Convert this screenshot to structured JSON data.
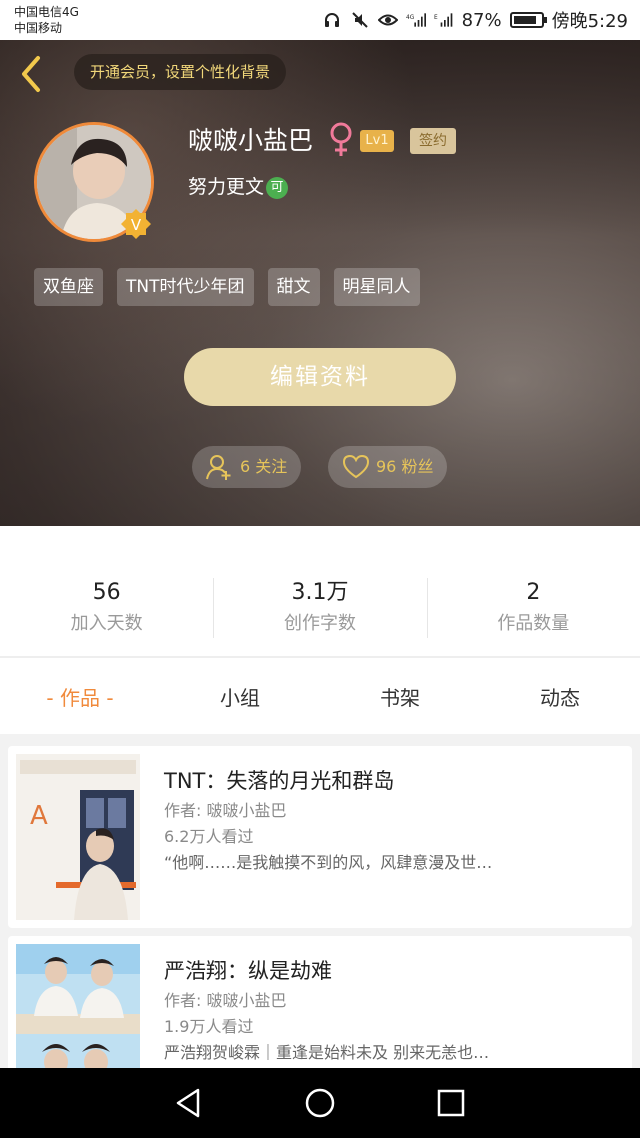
{
  "status_bar": {
    "carrier_line1": "中国电信4G",
    "carrier_line2": "中国移动",
    "battery_percent": "87%",
    "battery_level": 0.87,
    "time": "傍晚5:29",
    "icons": [
      "headphones-icon",
      "mute-icon",
      "eye-icon",
      "signal-4g-icon",
      "signal-e-icon",
      "battery-icon"
    ]
  },
  "header": {
    "vip_prompt": "开通会员，设置个性化背景",
    "username": "啵啵小盐巴",
    "gender_symbol": "♀",
    "level": "Lv1",
    "sign_badge": "签约",
    "motto": "努力更文",
    "motto_badge": "可",
    "verified_badge": "V",
    "tags": [
      "双鱼座",
      "TNT时代少年团",
      "甜文",
      "明星同人"
    ],
    "edit_button": "编辑资料",
    "follow_count": "6 关注",
    "fans_count": "96 粉丝",
    "accent_color": "#e6c45a"
  },
  "stats": [
    {
      "value": "56",
      "label": "加入天数"
    },
    {
      "value": "3.1万",
      "label": "创作字数"
    },
    {
      "value": "2",
      "label": "作品数量"
    }
  ],
  "tabs": [
    {
      "label": "- 作品 -",
      "active": true
    },
    {
      "label": "小组",
      "active": false
    },
    {
      "label": "书架",
      "active": false
    },
    {
      "label": "动态",
      "active": false
    }
  ],
  "books": [
    {
      "title": "TNT：失落的月光和群岛",
      "author": "作者: 啵啵小盐巴",
      "views": "6.2万人看过",
      "description": "“他啊……是我触摸不到的风，风肆意漫及世…"
    },
    {
      "title": "严浩翔：纵是劫难",
      "author": "作者: 啵啵小盐巴",
      "views": "1.9万人看过",
      "description": "严浩翔贺峻霖｜重逢是始料未及 别来无恙也…"
    }
  ]
}
